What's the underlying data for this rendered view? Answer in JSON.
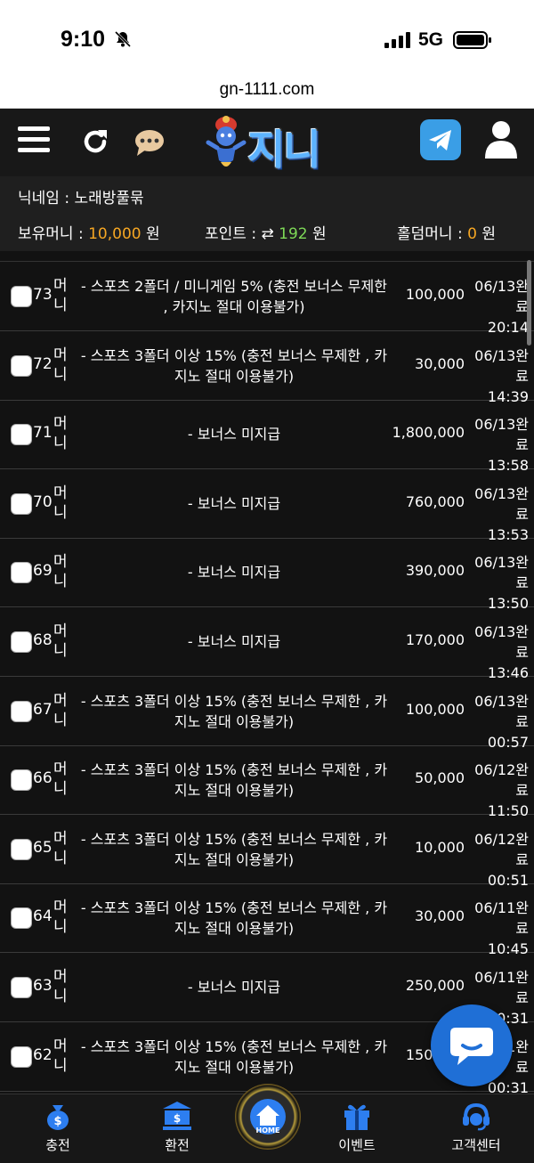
{
  "status_bar": {
    "time": "9:10",
    "network": "5G"
  },
  "browser": {
    "url": "gn-1111.com"
  },
  "header": {
    "logo_text": "지니"
  },
  "user_info": {
    "nickname_label": "닉네임 : ",
    "nickname": "노래방풀묶",
    "money_label": "보유머니 : ",
    "money_value": "10,000",
    "money_unit": " 원",
    "point_label": "포인트 : ",
    "point_value": "192",
    "point_unit": " 원",
    "holdem_label": "홀덤머니 : ",
    "holdem_value": "0",
    "holdem_unit": " 원"
  },
  "rows": [
    {
      "num": "73",
      "type": "머니",
      "title": "- 스포츠 2폴더 / 미니게임 5% (충전 보너스 무제한 , 카지노 절대 이용불가)",
      "amount": "100,000",
      "date": "06/13",
      "status": "완료",
      "time": "20:14"
    },
    {
      "num": "72",
      "type": "머니",
      "title": "- 스포츠 3폴더 이상 15% (충전 보너스 무제한 , 카지노 절대 이용불가)",
      "amount": "30,000",
      "date": "06/13",
      "status": "완료",
      "time": "14:39"
    },
    {
      "num": "71",
      "type": "머니",
      "title": "- 보너스 미지급",
      "amount": "1,800,000",
      "date": "06/13",
      "status": "완료",
      "time": "13:58"
    },
    {
      "num": "70",
      "type": "머니",
      "title": "- 보너스 미지급",
      "amount": "760,000",
      "date": "06/13",
      "status": "완료",
      "time": "13:53"
    },
    {
      "num": "69",
      "type": "머니",
      "title": "- 보너스 미지급",
      "amount": "390,000",
      "date": "06/13",
      "status": "완료",
      "time": "13:50"
    },
    {
      "num": "68",
      "type": "머니",
      "title": "- 보너스 미지급",
      "amount": "170,000",
      "date": "06/13",
      "status": "완료",
      "time": "13:46"
    },
    {
      "num": "67",
      "type": "머니",
      "title": "- 스포츠 3폴더 이상 15% (충전 보너스 무제한 , 카지노 절대 이용불가)",
      "amount": "100,000",
      "date": "06/13",
      "status": "완료",
      "time": "00:57"
    },
    {
      "num": "66",
      "type": "머니",
      "title": "- 스포츠 3폴더 이상 15% (충전 보너스 무제한 , 카지노 절대 이용불가)",
      "amount": "50,000",
      "date": "06/12",
      "status": "완료",
      "time": "11:50"
    },
    {
      "num": "65",
      "type": "머니",
      "title": "- 스포츠 3폴더 이상 15% (충전 보너스 무제한 , 카지노 절대 이용불가)",
      "amount": "10,000",
      "date": "06/12",
      "status": "완료",
      "time": "00:51"
    },
    {
      "num": "64",
      "type": "머니",
      "title": "- 스포츠 3폴더 이상 15% (충전 보너스 무제한 , 카지노 절대 이용불가)",
      "amount": "30,000",
      "date": "06/11",
      "status": "완료",
      "time": "10:45"
    },
    {
      "num": "63",
      "type": "머니",
      "title": "- 보너스 미지급",
      "amount": "250,000",
      "date": "06/11",
      "status": "완료",
      "time": "00:31"
    },
    {
      "num": "62",
      "type": "머니",
      "title": "- 스포츠 3폴더 이상 15% (충전 보너스 무제한 , 카지노 절대 이용불가)",
      "amount": "150,000",
      "date": "06/11",
      "status": "완료",
      "time": "00:31"
    }
  ],
  "bottom_nav": {
    "deposit": "충전",
    "withdraw": "환전",
    "home": "HOME",
    "event": "이벤트",
    "support": "고객센터"
  },
  "colors": {
    "accent_orange": "#f5a623",
    "accent_green": "#7ed957",
    "brand_blue": "#2d7ef0"
  }
}
